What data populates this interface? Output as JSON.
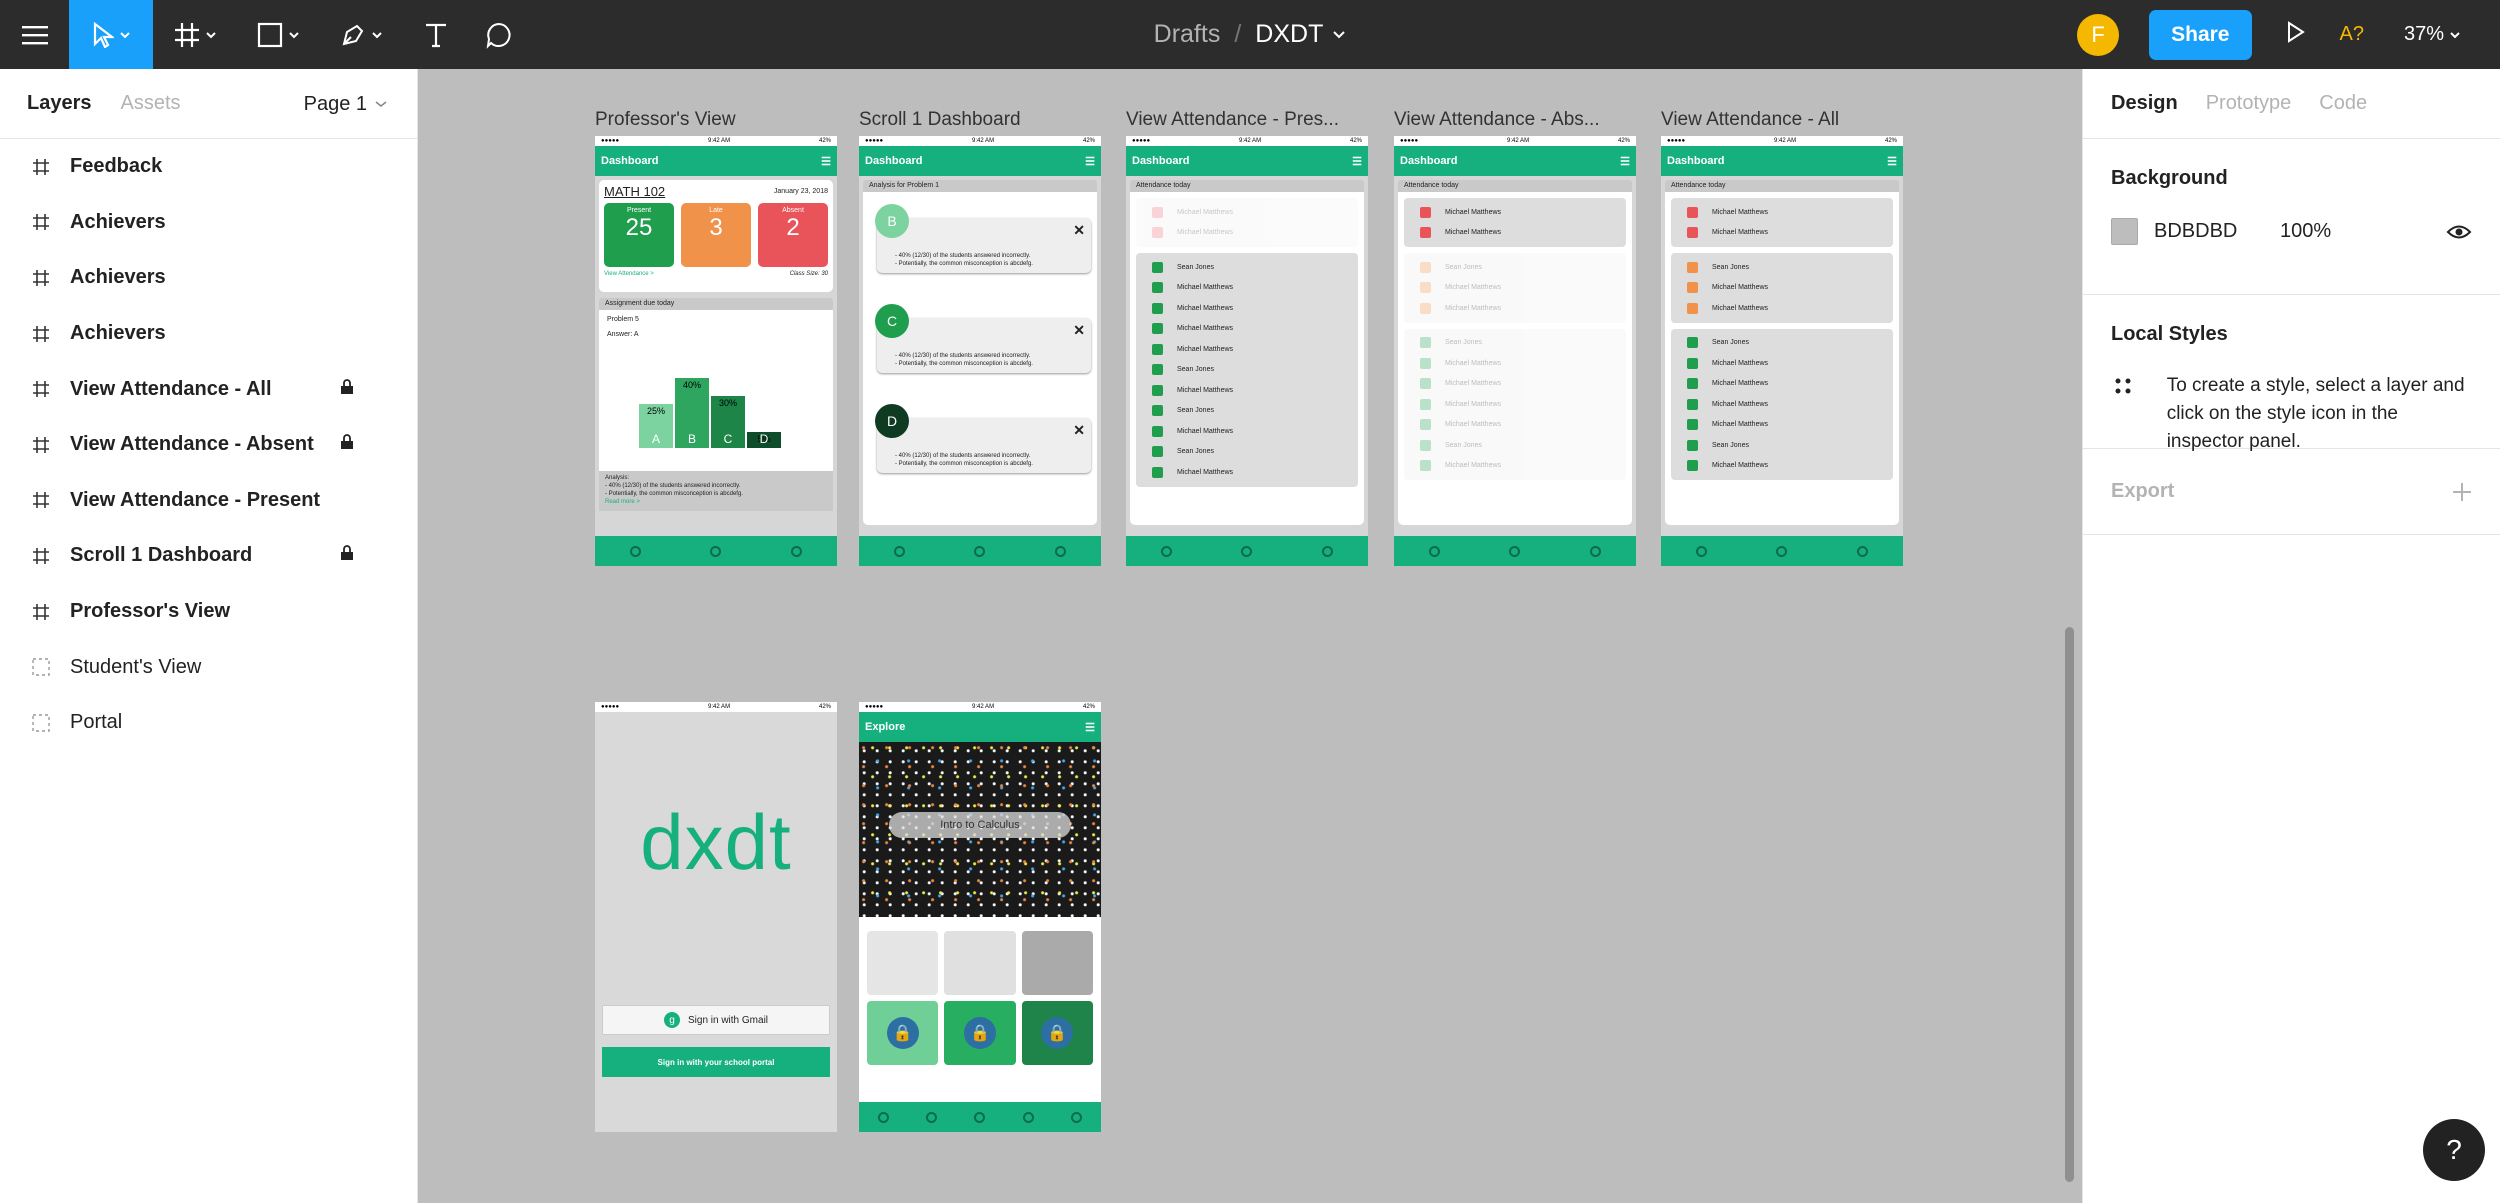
{
  "toolbar": {
    "breadcrumb": "Drafts",
    "separator": "/",
    "file_name": "DXDT",
    "avatar_initial": "F",
    "share_label": "Share",
    "a11y_label": "A?",
    "zoom": "37%"
  },
  "left_panel": {
    "tabs": [
      "Layers",
      "Assets"
    ],
    "page": "Page 1",
    "layers": [
      {
        "name": "Feedback",
        "type": "frame",
        "locked": false
      },
      {
        "name": "Achievers",
        "type": "frame",
        "locked": false
      },
      {
        "name": "Achievers",
        "type": "frame",
        "locked": false
      },
      {
        "name": "Achievers",
        "type": "frame",
        "locked": false
      },
      {
        "name": "View Attendance - All",
        "type": "frame",
        "locked": true
      },
      {
        "name": "View Attendance - Absent",
        "type": "frame",
        "locked": true
      },
      {
        "name": "View Attendance - Present",
        "type": "frame",
        "locked": false
      },
      {
        "name": "Scroll 1 Dashboard",
        "type": "frame",
        "locked": true
      },
      {
        "name": "Professor's View",
        "type": "frame",
        "locked": false
      },
      {
        "name": "Student's View",
        "type": "group",
        "locked": false
      },
      {
        "name": "Portal",
        "type": "group",
        "locked": false
      }
    ]
  },
  "canvas": {
    "frame_labels": [
      "Professor's View",
      "Scroll 1 Dashboard",
      "View Attendance - Pres...",
      "View Attendance - Abs...",
      "View Attendance - All"
    ],
    "status_time": "9:42 AM",
    "status_battery": "42%",
    "header_dashboard": "Dashboard",
    "header_explore": "Explore",
    "professor": {
      "course": "MATH 102",
      "date": "January 23, 2018",
      "present_label": "Present",
      "present_value": "25",
      "late_label": "Late",
      "late_value": "3",
      "absent_label": "Absent",
      "absent_value": "2",
      "view_attendance": "View Attendance >",
      "class_size": "Class Size: 30",
      "assignment": "Assignment due today",
      "problem": "Problem 5",
      "answer": "Answer: A",
      "bars": [
        {
          "label": "A",
          "pct": "25%",
          "value": 25
        },
        {
          "label": "B",
          "pct": "40%",
          "value": 40
        },
        {
          "label": "C",
          "pct": "30%",
          "value": 30
        },
        {
          "label": "D",
          "pct": "5%",
          "value": 5
        }
      ],
      "analysis": "Analysis:",
      "analysis_line1": "- 40% (12/30) of the students answered incorrectly.",
      "analysis_line2": "- Potentially, the common misconception is abcdefg.",
      "read_more": "Read more >"
    },
    "scroll": {
      "title": "Analysis for Problem 1",
      "items": [
        "B",
        "C",
        "D"
      ],
      "line1": "- 40% (12/30) of the students answered incorrectly.",
      "line2": "- Potentially, the common misconception is abcdefg."
    },
    "attendance_title": "Attendance today",
    "names": [
      "Sean Jones",
      "Michael Matthews",
      "Michael Matthews",
      "Michael Matthews",
      "Michael Matthews",
      "Sean Jones",
      "Michael Matthews",
      "Sean Jones",
      "Michael Matthews",
      "Sean Jones",
      "Michael Matthews"
    ],
    "portal": {
      "logo": "dxdt",
      "gmail": "Sign in with Gmail",
      "school": "Sign in with your school portal"
    },
    "student": {
      "banner": "Intro to Calculus"
    }
  },
  "right_panel": {
    "tabs": [
      "Design",
      "Prototype",
      "Code"
    ],
    "background_heading": "Background",
    "bg_hex": "BDBDBD",
    "bg_opacity": "100%",
    "local_styles_heading": "Local Styles",
    "local_styles_text": "To create a style, select a layer and click on the style icon in the inspector panel.",
    "export_heading": "Export"
  },
  "help_label": "?",
  "colors": {
    "toolbar": "#2c2c2c",
    "accent": "#18a0fb",
    "app_green": "#16b07e",
    "canvas": "#bdbdbd",
    "present_green": "#1f9e4e",
    "late_orange": "#f0924a",
    "absent_red": "#e8545a"
  }
}
